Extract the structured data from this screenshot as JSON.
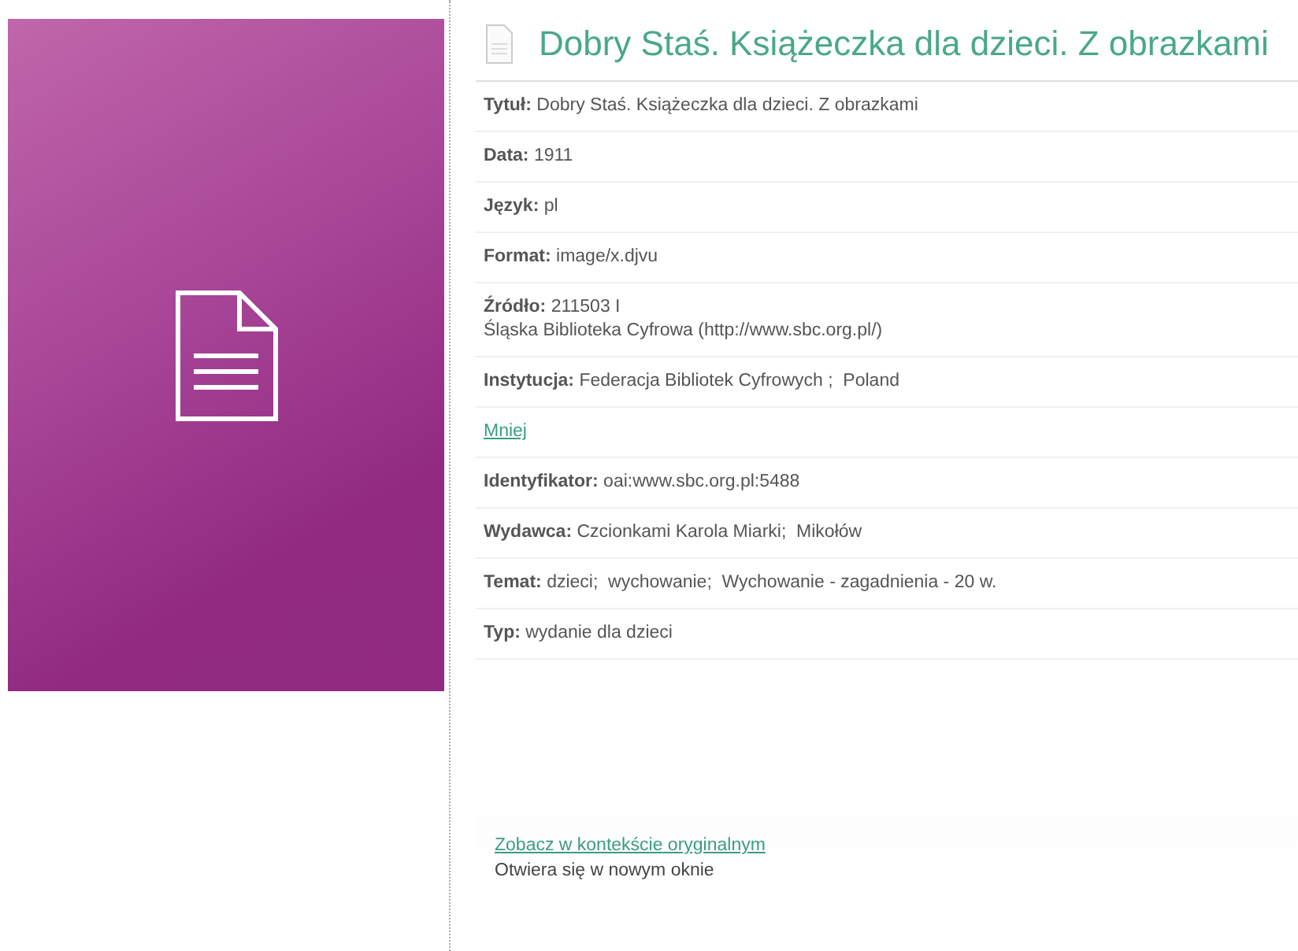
{
  "title": "Dobry Staś. Książeczka dla dzieci. Z obrazkami",
  "fields": [
    {
      "kind": "field",
      "label": "Tytuł:",
      "lines": [
        "Dobry Staś. Książeczka dla dzieci. Z obrazkami"
      ]
    },
    {
      "kind": "field",
      "label": "Data:",
      "lines": [
        "1911"
      ]
    },
    {
      "kind": "field",
      "label": "Język:",
      "lines": [
        "pl"
      ]
    },
    {
      "kind": "field",
      "label": "Format:",
      "lines": [
        "image/x.djvu"
      ]
    },
    {
      "kind": "field",
      "label": "Źródło:",
      "lines": [
        "211503 I",
        "Śląska Biblioteka Cyfrowa (http://www.sbc.org.pl/)"
      ]
    },
    {
      "kind": "field",
      "label": "Instytucja:",
      "lines": [
        "Federacja Bibliotek Cyfrowych ;  Poland"
      ]
    },
    {
      "kind": "link",
      "text": "Mniej"
    },
    {
      "kind": "field",
      "label": "Identyfikator:",
      "lines": [
        "oai:www.sbc.org.pl:5488"
      ]
    },
    {
      "kind": "field",
      "label": "Wydawca:",
      "lines": [
        "Czcionkami Karola Miarki;  Mikołów"
      ]
    },
    {
      "kind": "field",
      "label": "Temat:",
      "lines": [
        "dzieci;  wychowanie;  Wychowanie - zagadnienia - 20 w."
      ]
    },
    {
      "kind": "field",
      "label": "Typ:",
      "lines": [
        "wydanie dla dzieci"
      ]
    }
  ],
  "context_link": {
    "text": "Zobacz w kontekście oryginalnym",
    "note": "Otwiera się w nowym oknie"
  }
}
